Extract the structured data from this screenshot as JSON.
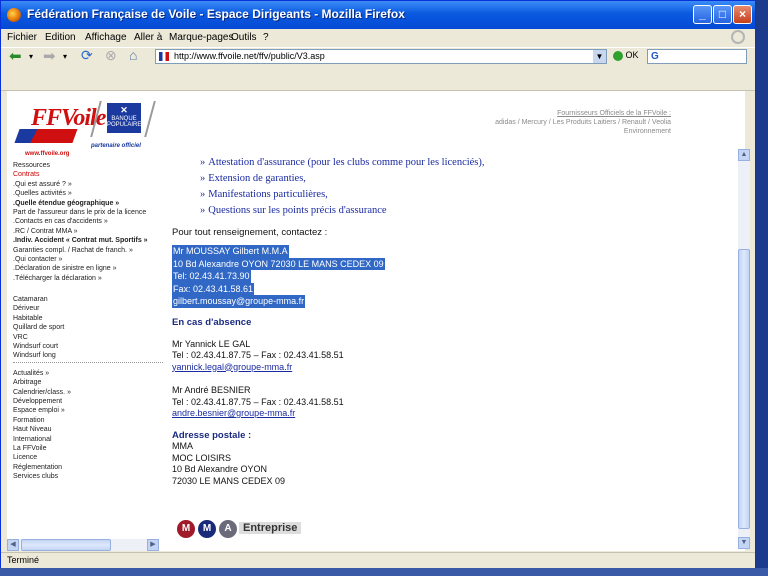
{
  "window": {
    "title": "Fédération Française de Voile - Espace Dirigeants - Mozilla Firefox"
  },
  "menubar": {
    "items": [
      "Fichier",
      "Edition",
      "Affichage",
      "Aller à",
      "Marque-pages",
      "Outils",
      "?"
    ]
  },
  "navbar": {
    "url": "http://www.ffvoile.net/ffv/public/V3.asp",
    "go_label": "OK",
    "search_placeholder": "G"
  },
  "header": {
    "logo_text": "FFVoile",
    "logo_site": "www.ffvoile.org",
    "partner_label": "partenaire officiel",
    "bp_logo_text": "BANQUE POPULAIRE",
    "suppliers_title": "Fournisseurs Officiels de la FFVoile :",
    "suppliers_line1": "adidas / Mercury / Les Produits Laitiers / Renault / Veolia",
    "suppliers_line2": "Environnement"
  },
  "sidebar": {
    "items": [
      {
        "label": "Ressources",
        "style": "normal"
      },
      {
        "label": "Contrats",
        "style": "red"
      },
      {
        "label": ".Qui est assuré ? »",
        "style": "normal"
      },
      {
        "label": ".Quelles activités »",
        "style": "normal"
      },
      {
        "label": ".Quelle étendue géographique »",
        "style": "bold"
      },
      {
        "label": "  Part de l'assureur dans le prix de la licence",
        "style": "normal"
      },
      {
        "label": ".Contacts en cas d'accidents »",
        "style": "normal"
      },
      {
        "label": ".RC / Contrat MMA »",
        "style": "normal"
      },
      {
        "label": ".Indiv. Accident « Contrat mut. Sportifs »",
        "style": "bold"
      },
      {
        "label": "  Garanties compl. / Rachat de franch. »",
        "style": "normal"
      },
      {
        "label": ".Qui contacter »",
        "style": "normal"
      },
      {
        "label": ".Déclaration de sinistre en ligne »",
        "style": "normal"
      },
      {
        "label": ".Télécharger la déclaration »",
        "style": "normal"
      },
      {
        "label": "",
        "style": "gap"
      },
      {
        "label": "Catamaran",
        "style": "normal"
      },
      {
        "label": "Dériveur",
        "style": "normal"
      },
      {
        "label": "Habitable",
        "style": "normal"
      },
      {
        "label": "Quillard de sport",
        "style": "normal"
      },
      {
        "label": "VRC",
        "style": "normal"
      },
      {
        "label": "Windsurf court",
        "style": "normal"
      },
      {
        "label": "Windsurf long",
        "style": "normal"
      },
      {
        "label": "",
        "style": "hr"
      },
      {
        "label": "Actualités »",
        "style": "normal"
      },
      {
        "label": "Arbitrage",
        "style": "normal"
      },
      {
        "label": "Calendrier/class. »",
        "style": "normal"
      },
      {
        "label": "Développement",
        "style": "normal"
      },
      {
        "label": "Espace emploi »",
        "style": "normal"
      },
      {
        "label": "Formation",
        "style": "normal"
      },
      {
        "label": "Haut Niveau",
        "style": "normal"
      },
      {
        "label": "International",
        "style": "normal"
      },
      {
        "label": "La FFVoile",
        "style": "normal"
      },
      {
        "label": "Licence",
        "style": "normal"
      },
      {
        "label": "Réglementation",
        "style": "normal"
      },
      {
        "label": "Services clubs",
        "style": "normal"
      }
    ]
  },
  "main": {
    "bullets": [
      "Attestation d'assurance (pour les clubs comme pour les licenciés),",
      "Extension de garanties,",
      "Manifestations particulières,",
      "Questions sur les points précis d'assurance"
    ],
    "pour_text": "Pour tout renseignement, contactez :",
    "selected_lines": [
      "Mr MOUSSAY Gilbert   M.M.A",
      "10 Bd Alexandre OYON   72030 LE MANS CEDEX 09",
      "Tel: 02.43.41.73.90",
      "Fax: 02.43.41.58.61",
      "gilbert.moussay@groupe-mma.fr"
    ],
    "absence": {
      "heading": "En cas d'absence",
      "c1_name": "Mr Yannick LE GAL",
      "c1_tel": "Tel : 02.43.41.87.75 – Fax : 02.43.41.58.51",
      "c1_email": "yannick.legal@groupe-mma.fr",
      "c2_name": "Mr André BESNIER",
      "c2_tel": "Tel : 02.43.41.87.75 – Fax : 02.43.41.58.51",
      "c2_email": "andre.besnier@groupe-mma.fr"
    },
    "postal": {
      "heading": "Adresse postale :",
      "l1": "MMA",
      "l2": "MOC LOISIRS",
      "l3": "10 Bd Alexandre OYON",
      "l4": "72030 LE MANS CEDEX 09"
    },
    "mma_logo": {
      "m1": "M",
      "m2": "M",
      "a": "A",
      "word": "Entreprise"
    }
  },
  "status": {
    "text": "Terminé"
  }
}
